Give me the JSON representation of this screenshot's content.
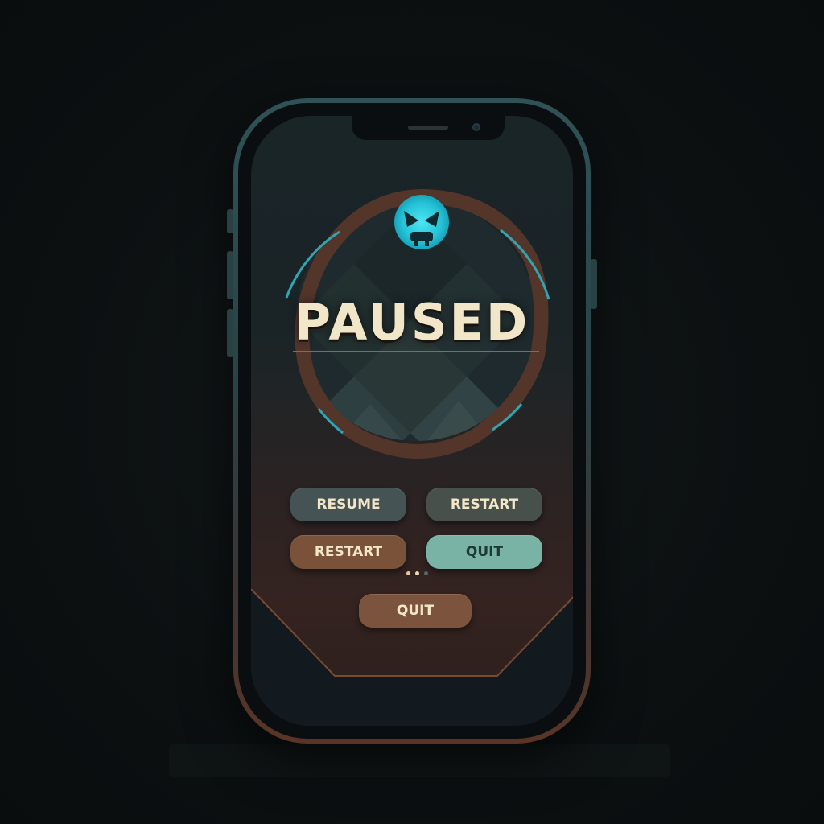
{
  "screen": {
    "title": "PAUSED"
  },
  "menu": {
    "resume_label": "RESUME",
    "restart_label_1": "RESTART",
    "restart_label_2": "RESTART",
    "quit_label_1": "QUIT",
    "quit_label_2": "QUIT"
  },
  "page_indicator": {
    "count": 3,
    "active_index": 1
  },
  "icons": {
    "emblem": "angry-skull-icon"
  },
  "colors": {
    "accent_cyan": "#3fd6e6",
    "title_cream": "#f2e6c8",
    "frame_brown": "#5a3526",
    "quit_teal": "#78b3a6"
  }
}
